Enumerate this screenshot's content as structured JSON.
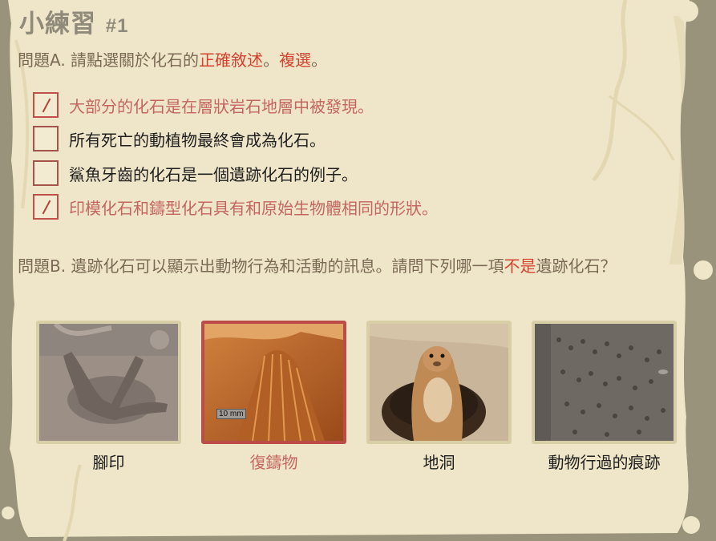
{
  "title": {
    "text": "小練習",
    "number": "#1"
  },
  "questionA": {
    "prefix": "問題",
    "letter": "A",
    "text_before": ". 請點選關於化石的",
    "highlight": "正確敘述",
    "text_mid": "。",
    "highlight2": "複選",
    "text_after": "。",
    "options": [
      {
        "label": "大部分的化石是在層狀岩石地層中被發現。",
        "checked": true
      },
      {
        "label": "所有死亡的動植物最終會成為化石。",
        "checked": false
      },
      {
        "label": "鯊魚牙齒的化石是一個遺跡化石的例子。",
        "checked": false
      },
      {
        "label": "印模化石和鑄型化石具有和原始生物體相同的形狀。",
        "checked": true
      }
    ]
  },
  "questionB": {
    "prefix": "問題",
    "letter": "B",
    "text_before": ". 遺跡化石可以顯示出動物行為和活動的訊息。請問下列哪一項",
    "highlight": "不是",
    "text_after": "遺跡化石？",
    "choices": [
      {
        "label": "腳印",
        "selected": false
      },
      {
        "label": "復鑄物",
        "selected": true,
        "scale_label": "10 mm"
      },
      {
        "label": "地洞",
        "selected": false
      },
      {
        "label": "動物行過的痕跡",
        "selected": false
      }
    ]
  },
  "colors": {
    "accent_red": "#d2422f",
    "selected_border": "#bd4c49",
    "paper": "#efe6c9"
  }
}
